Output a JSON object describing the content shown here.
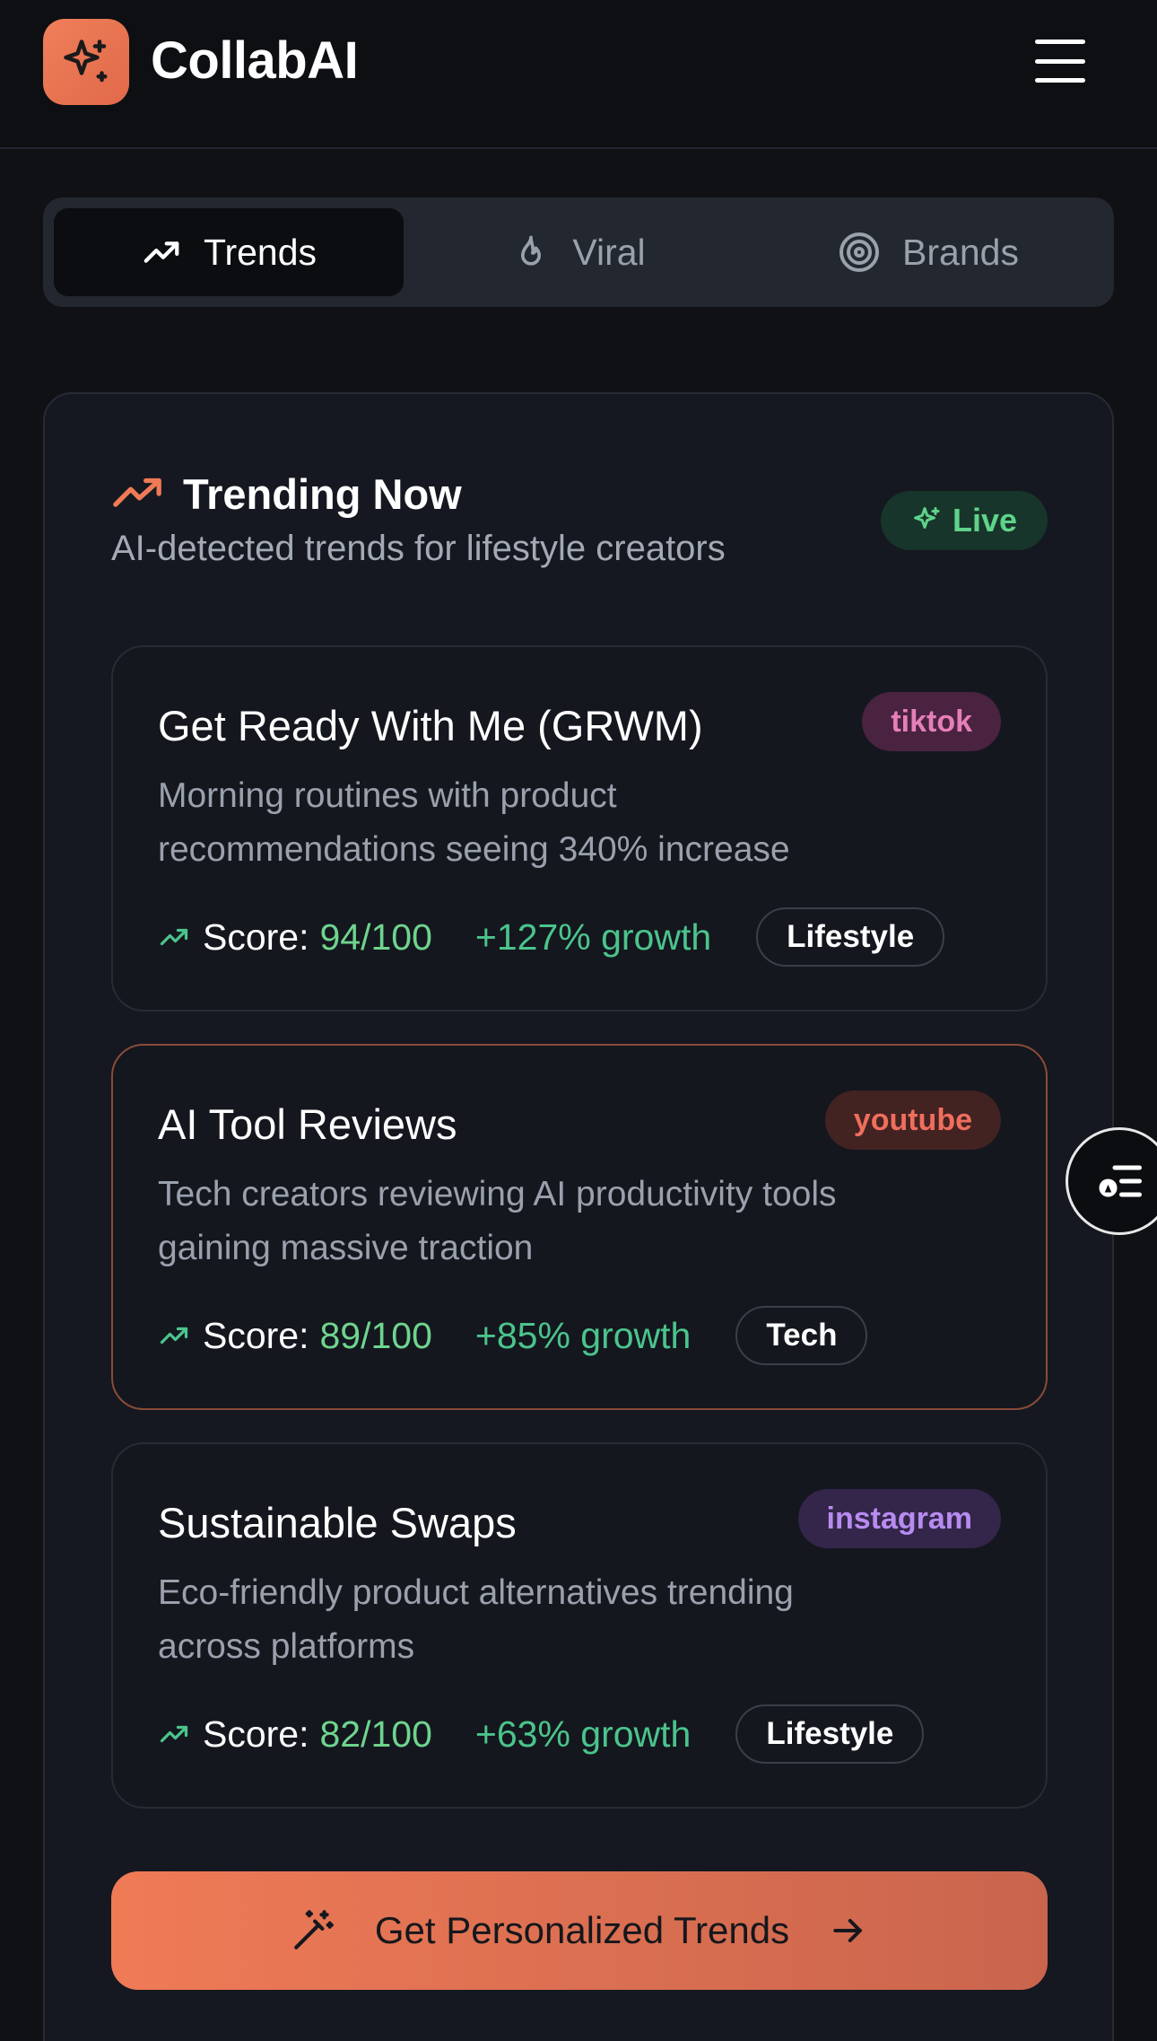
{
  "app": {
    "title": "CollabAI",
    "accent_color": "#ef7a56",
    "logo_icon": "sparkles-icon"
  },
  "header": {
    "menu_icon": "hamburger-menu-icon"
  },
  "tabs": [
    {
      "label": "Trends",
      "icon": "trending-up-icon",
      "active": true
    },
    {
      "label": "Viral",
      "icon": "flame-icon",
      "active": false
    },
    {
      "label": "Brands",
      "icon": "target-icon",
      "active": false
    }
  ],
  "panel": {
    "title": "Trending Now",
    "subtitle": "AI-detected trends for lifestyle creators",
    "badge": "Live"
  },
  "trends": [
    {
      "title": "Get Ready With Me (GRWM)",
      "description": "Morning routines with product recommendations seeing 340% increase",
      "platform": "tiktok",
      "platform_bg": "#4a2340",
      "platform_color": "#e57fb8",
      "score_label": "Score:",
      "score": "94/100",
      "growth": "+127% growth",
      "category": "Lifestyle"
    },
    {
      "title": "AI Tool Reviews",
      "description": "Tech creators reviewing AI productivity tools gaining massive traction",
      "platform": "youtube",
      "platform_bg": "#432222",
      "platform_color": "#ef6e5c",
      "score_label": "Score:",
      "score": "89/100",
      "growth": "+85% growth",
      "category": "Tech"
    },
    {
      "title": "Sustainable Swaps",
      "description": "Eco-friendly product alternatives trending across platforms",
      "platform": "instagram",
      "platform_bg": "#33264a",
      "platform_color": "#b88bf0",
      "score_label": "Score:",
      "score": "82/100",
      "growth": "+63% growth",
      "category": "Lifestyle"
    }
  ],
  "cta": {
    "label": "Get Personalized Trends"
  }
}
